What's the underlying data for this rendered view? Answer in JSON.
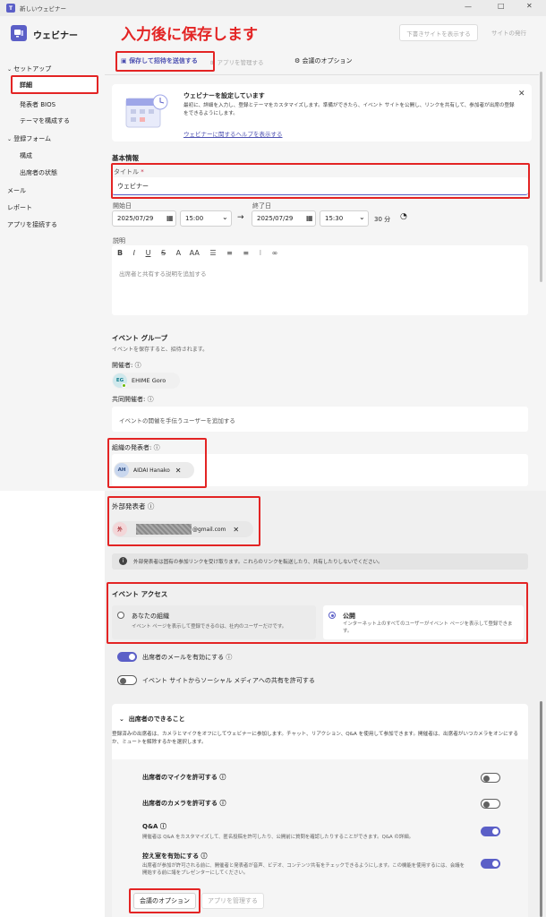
{
  "window": {
    "title": "新しいウェビナー",
    "controls": [
      "—",
      "□",
      "✕"
    ]
  },
  "app": {
    "name": "ウェビナー"
  },
  "annotation": {
    "title": "入力後に保存します"
  },
  "header": {
    "save_draft": "下書きサイトを表示する",
    "publish": "サイトの発行"
  },
  "toolbar": {
    "save_send": "保存して招待を送信する",
    "manage_apps": "アプリを管理する",
    "meeting_options": "会議のオプション"
  },
  "sidebar": {
    "setup": "セットアップ",
    "details": "詳細",
    "presenter_bios": "発表者 BIOS",
    "theme": "テーマを構成する",
    "registration": "登録フォーム",
    "configure": "構成",
    "attendee_status": "出席者の状態",
    "email": "メール",
    "report": "レポート",
    "connect_apps": "アプリを接続する"
  },
  "banner": {
    "title": "ウェビナーを設定しています",
    "body": "最初に、詳細を入力し、登録とテーマをカスタマイズします。準備ができたら、イベント サイトを公開し、リンクを共有して、参加者が出席の登録をできるようにします。",
    "link": "ウェビナーに関するヘルプを表示する"
  },
  "basic": {
    "heading": "基本情報",
    "title_label": "タイトル",
    "title_required": "*",
    "title_value": "ウェビナー",
    "start_label": "開始日",
    "start_date": "2025/07/29",
    "start_time": "15:00",
    "end_label": "終了日",
    "end_date": "2025/07/29",
    "end_time": "15:30",
    "duration": "30 分",
    "desc_label": "説明",
    "desc_placeholder": "出席者と共有する説明を追加する"
  },
  "editor": {
    "bold": "B",
    "italic": "I",
    "underline": "U",
    "strike": "S",
    "size": "A",
    "font": "AA"
  },
  "group": {
    "heading": "イベント グループ",
    "sub": "イベントを保存すると、招待されます。",
    "organizer_label": "開催者:",
    "organizer_initials": "EG",
    "organizer_name": "EHIME Goro",
    "coorganizer_label": "共同開催者:",
    "coorganizer_placeholder": "イベントの開催を手伝うユーザーを追加する",
    "org_presenters_label": "組織の発表者:",
    "org_presenter_initials": "AH",
    "org_presenter_name": "AIDAI Hanako"
  },
  "external": {
    "label": "外部発表者",
    "initial": "外",
    "email_suffix": "@gmail.com",
    "notice": "外部発表者は固有の参加リンクを受け取ります。これらのリンクを転送したり、共有したりしないでください。"
  },
  "access": {
    "heading": "イベント アクセス",
    "org_label": "あなたの組織",
    "org_desc": "イベント ページを表示して登録できるのは、社内のユーザーだけです。",
    "public_label": "公開",
    "public_desc": "インターネット上のすべてのユーザーがイベント ページを表示して登録できます。"
  },
  "toggles": {
    "attendee_email": "出席者のメールを有効にする",
    "social_share": "イベント サイトからソーシャル メディアへの共有を許可する"
  },
  "capabilities": {
    "heading": "出席者のできること",
    "desc": "登録済みの出席者は、カメラとマイクをオフにしてウェビナーに参加します。チャット、リアクション、Q&A を使用して参加できます。開催者は、出席者がいつカメラをオンにするか、ミュートを解除するかを選択します。",
    "mic": "出席者のマイクを許可する",
    "camera": "出席者のカメラを許可する",
    "qa": "Q&A",
    "qa_desc": "開催者は Q&A をカスタマイズして、匿名投稿を許可したり、公開前に質問を確認したりすることができます。Q&A の詳細。",
    "lobby": "控え室を有効にする",
    "lobby_desc": "出席者が参加が許可される前に、開催者と発表者が音声、ビデオ、コンテンツ共有をチェックできるようにします。この機能を使用するには、会議を開始する前に諸をプレゼンターにしてください。"
  },
  "footer": {
    "meeting_options": "会議のオプション",
    "manage_apps": "アプリを管理する"
  },
  "colors": {
    "accent": "#5b5fc7",
    "annotation": "#e32424",
    "link": "#4f52b2"
  }
}
